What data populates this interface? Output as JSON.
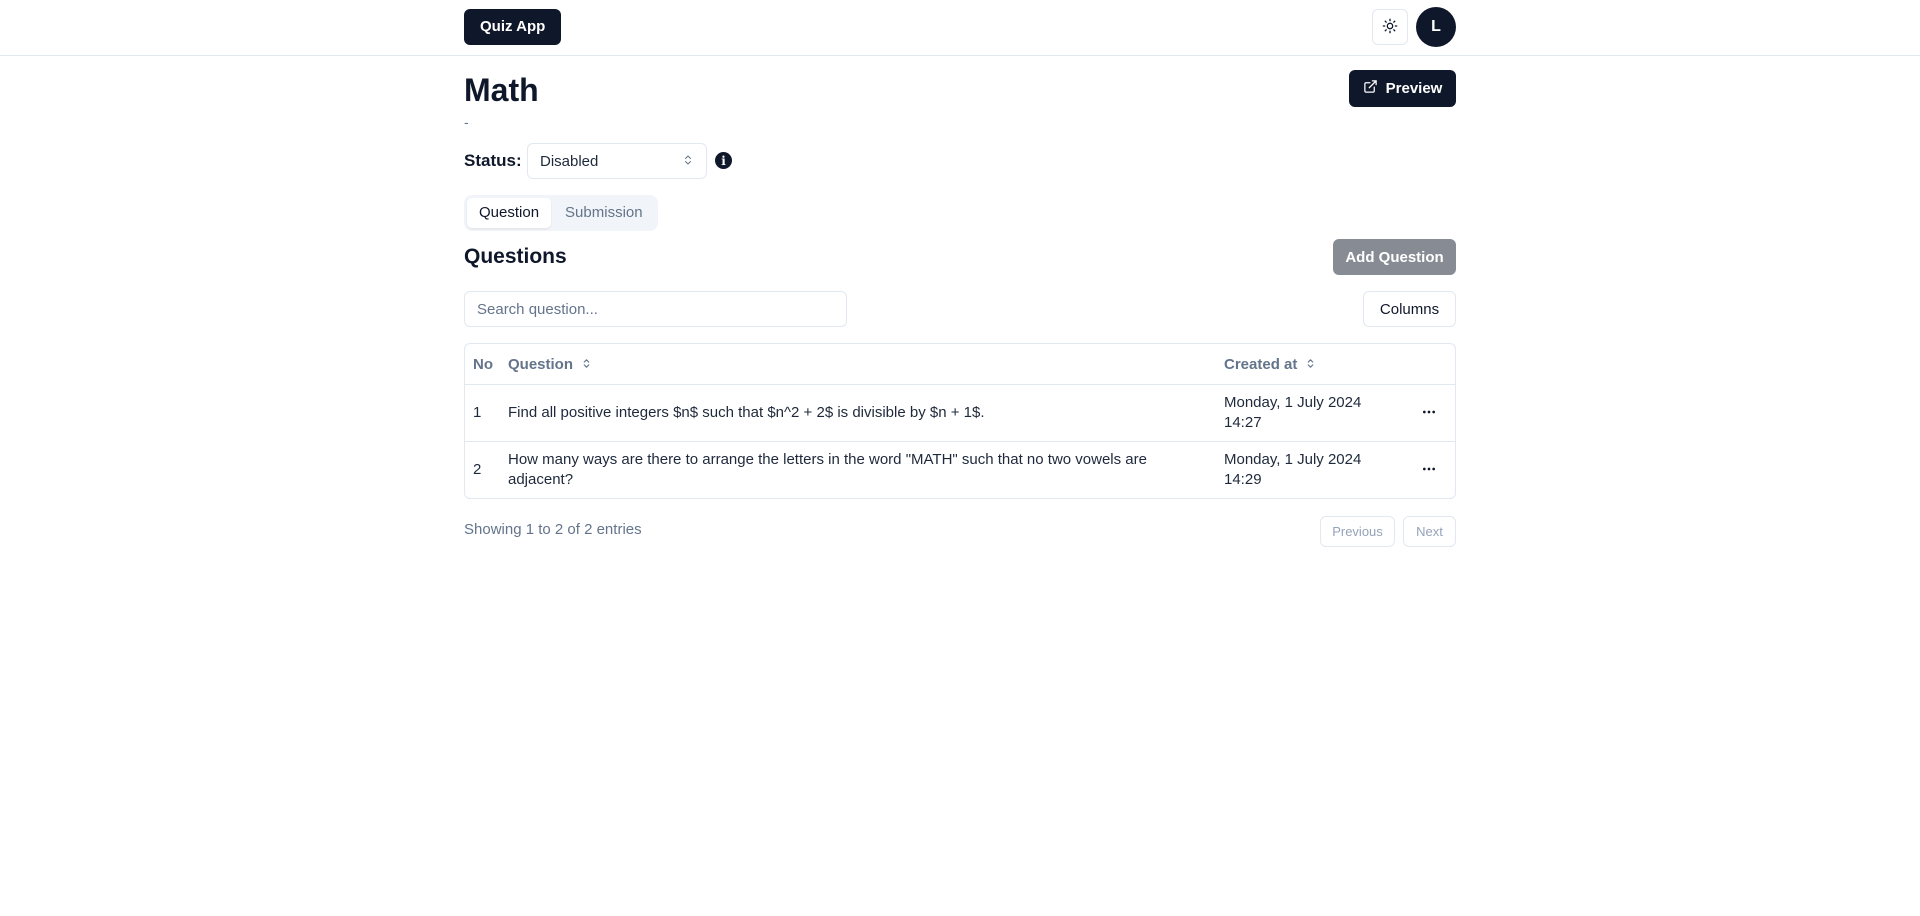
{
  "header": {
    "brand": "Quiz App",
    "avatar_initial": "L",
    "theme_icon": "sun-icon"
  },
  "quiz": {
    "title": "Math",
    "subtitle": "-",
    "preview_label": "Preview",
    "status_label": "Status:",
    "status_value": "Disabled",
    "info_icon": "info-icon"
  },
  "tabs": [
    {
      "label": "Question",
      "active": true
    },
    {
      "label": "Submission",
      "active": false
    }
  ],
  "questions": {
    "title": "Questions",
    "add_label": "Add Question",
    "search_placeholder": "Search question...",
    "columns_label": "Columns",
    "columns": {
      "no": "No",
      "question": "Question",
      "created_at": "Created at"
    },
    "rows": [
      {
        "no": "1",
        "question": "Find all positive integers $n$ such that $n^2 + 2$ is divisible by $n + 1$.",
        "date": "Monday, 1 July 2024",
        "time": "14:27"
      },
      {
        "no": "2",
        "question": "How many ways are there to arrange the letters in the word \"MATH\" such that no two vowels are adjacent?",
        "date": "Monday, 1 July 2024",
        "time": "14:29"
      }
    ],
    "footer": {
      "showing": "Showing 1 to 2 of 2 entries",
      "previous": "Previous",
      "next": "Next"
    }
  },
  "colors": {
    "primary": "#0f172a",
    "muted": "#64748b",
    "border": "#e2e8f0",
    "disabled_button": "#878b93"
  }
}
